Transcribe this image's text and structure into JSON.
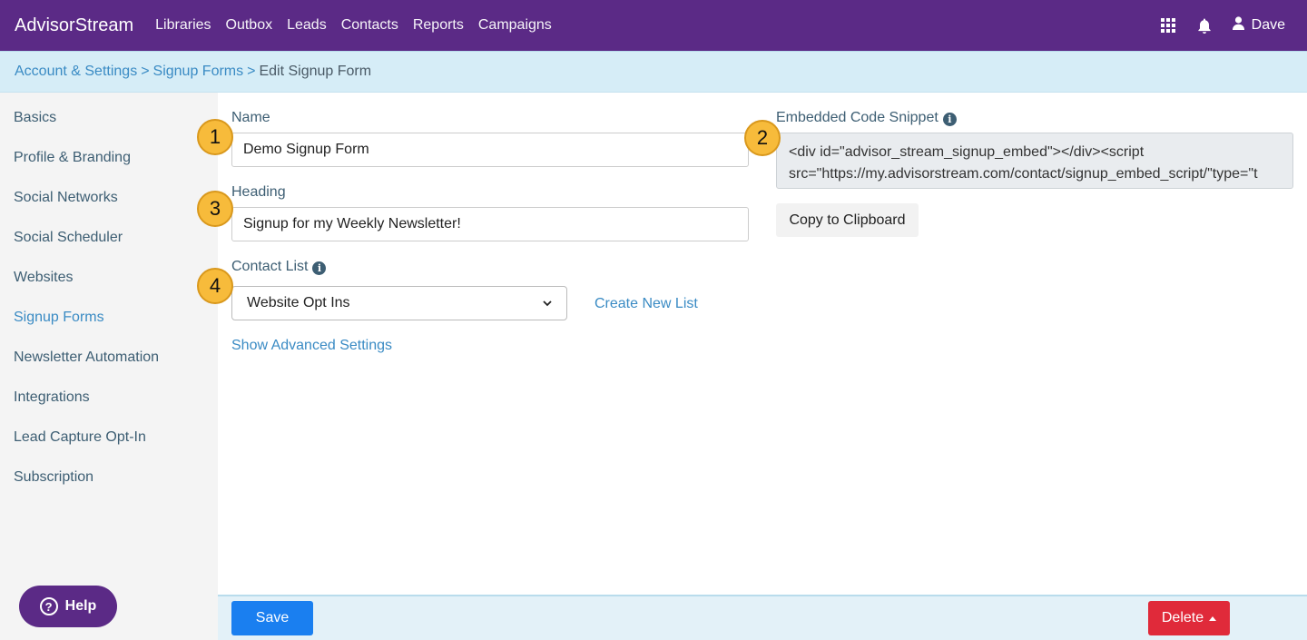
{
  "header": {
    "brand": "AdvisorStream",
    "nav": [
      "Libraries",
      "Outbox",
      "Leads",
      "Contacts",
      "Reports",
      "Campaigns"
    ],
    "user_name": "Dave",
    "icons": [
      "apps-grid-icon",
      "bell-icon",
      "user-icon"
    ]
  },
  "breadcrumb": {
    "items": [
      "Account & Settings",
      "Signup Forms"
    ],
    "separator": ">",
    "current": "Edit Signup Form"
  },
  "sidebar": {
    "items": [
      "Basics",
      "Profile & Branding",
      "Social Networks",
      "Social Scheduler",
      "Websites",
      "Signup Forms",
      "Newsletter Automation",
      "Integrations",
      "Lead Capture Opt-In",
      "Subscription"
    ],
    "active": "Signup Forms",
    "help_label": "Help"
  },
  "form": {
    "name_label": "Name",
    "name_value": "Demo Signup Form",
    "heading_label": "Heading",
    "heading_value": "Signup for my Weekly Newsletter!",
    "contact_list_label": "Contact List",
    "contact_list_value": "Website Opt Ins",
    "create_list_label": "Create New List",
    "advanced_label": "Show Advanced Settings",
    "embed_label": "Embedded Code Snippet",
    "embed_code_line1": "<div id=\"advisor_stream_signup_embed\"></div><script",
    "embed_code_line2": "src=\"https://my.advisorstream.com/contact/signup_embed_script/\"type=\"t",
    "copy_label": "Copy to Clipboard"
  },
  "callouts": [
    "1",
    "2",
    "3",
    "4"
  ],
  "footer": {
    "save_label": "Save",
    "delete_label": "Delete"
  },
  "colors": {
    "nav_bg": "#5b2a86",
    "breadcrumb_bg": "#d6edf7",
    "link": "#3a8bc4",
    "save": "#1a7ff0",
    "delete": "#e02a3a",
    "callout": "#f7bb3b"
  }
}
